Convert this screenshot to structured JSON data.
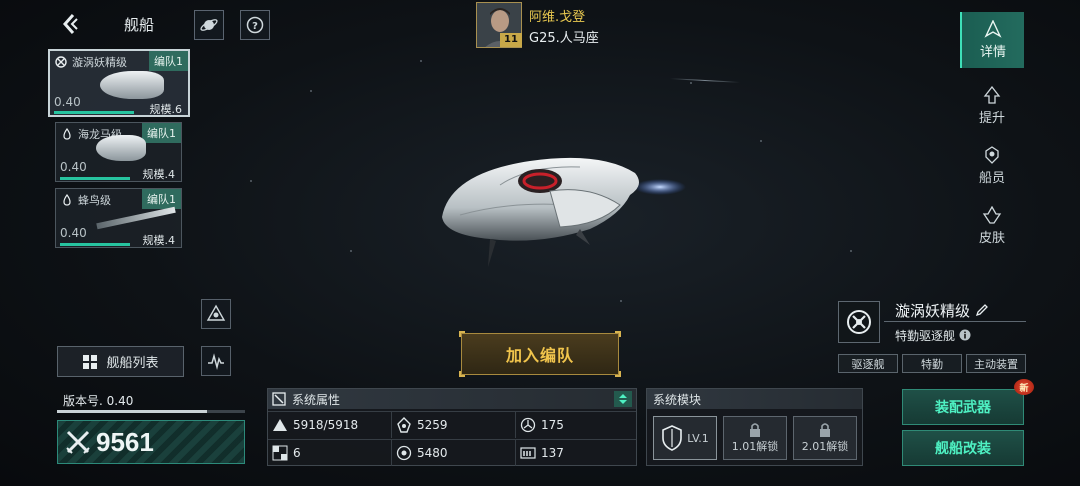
{
  "header": {
    "title": "舰船",
    "commander": {
      "name": "阿维.戈登",
      "sector": "G25.人马座",
      "level": "11"
    }
  },
  "fleet_cards": [
    {
      "name": "漩涡妖精级",
      "team": "编队1",
      "value": "0.40",
      "scale": "规模.6",
      "active": true
    },
    {
      "name": "海龙马级",
      "team": "编队1",
      "value": "0.40",
      "scale": "规模.4",
      "active": false
    },
    {
      "name": "蜂鸟级",
      "team": "编队1",
      "value": "0.40",
      "scale": "规模.4",
      "active": false
    }
  ],
  "side_nav": [
    {
      "label": "详情",
      "active": true
    },
    {
      "label": "提升",
      "active": false
    },
    {
      "label": "船员",
      "active": false
    },
    {
      "label": "皮肤",
      "active": false
    }
  ],
  "ship_info": {
    "name": "漩涡妖精级",
    "type": "特勤驱逐舰",
    "tags": [
      "驱逐舰",
      "特勤",
      "主动装置"
    ]
  },
  "join_button": "加入编队",
  "ship_list_button": "舰船列表",
  "version": {
    "label": "版本号. 0.40",
    "progress": 0.8
  },
  "power": "9561",
  "attributes": {
    "title": "系统属性",
    "cells": [
      "5918/5918",
      "5259",
      "175",
      "6",
      "5480",
      "137"
    ]
  },
  "modules": {
    "title": "系统模块",
    "slots": [
      "LV.1",
      "1.01解锁",
      "2.01解锁"
    ]
  },
  "actions": {
    "equip": "装配武器",
    "modify": "舰船改装",
    "new_badge": "新"
  },
  "colors": {
    "accent": "#3ee0b8",
    "gold": "#f0c44c",
    "team": "#2f6b5e"
  }
}
